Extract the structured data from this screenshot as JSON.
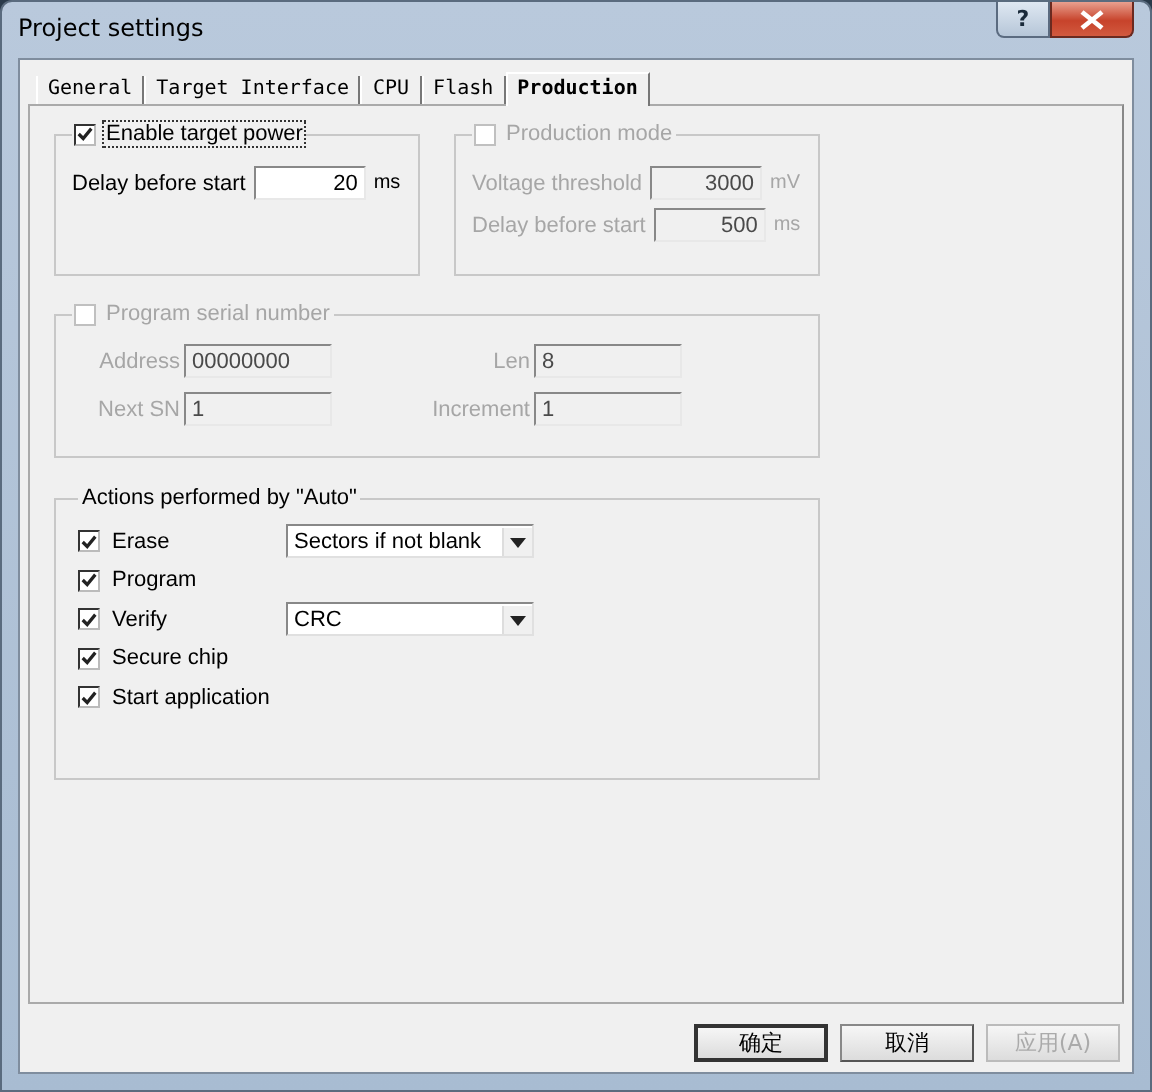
{
  "window": {
    "title": "Project settings",
    "help_button": "?"
  },
  "tabs": [
    {
      "label": "General",
      "selected": false
    },
    {
      "label": "Target Interface",
      "selected": false
    },
    {
      "label": "CPU",
      "selected": false
    },
    {
      "label": "Flash",
      "selected": false
    },
    {
      "label": "Production",
      "selected": true
    }
  ],
  "target_power": {
    "label": "Enable target power",
    "checked": true,
    "disabled": false,
    "fields": [
      {
        "label": "Delay before start",
        "value": "20",
        "unit": "ms"
      }
    ]
  },
  "production_mode": {
    "label": "Production mode",
    "checked": false,
    "disabled": true,
    "fields": [
      {
        "label": "Voltage threshold",
        "value": "3000",
        "unit": "mV"
      },
      {
        "label": "Delay before start",
        "value": "500",
        "unit": "ms"
      }
    ]
  },
  "serial_number": {
    "label": "Program serial number",
    "checked": false,
    "disabled": true,
    "fields": [
      {
        "label": "Address",
        "value": "00000000"
      },
      {
        "label": "Len",
        "value": "8"
      },
      {
        "label": "Next SN",
        "value": "1"
      },
      {
        "label": "Increment",
        "value": "1"
      }
    ]
  },
  "actions": {
    "title": "Actions performed by \"Auto\"",
    "items": [
      {
        "label": "Erase",
        "checked": true,
        "dropdown": "Sectors if not blank"
      },
      {
        "label": "Program",
        "checked": true
      },
      {
        "label": "Verify",
        "checked": true,
        "dropdown": "CRC"
      },
      {
        "label": "Secure chip",
        "checked": true
      },
      {
        "label": "Start application",
        "checked": true
      }
    ]
  },
  "buttons": [
    {
      "label": "确定",
      "disabled": false,
      "default": true
    },
    {
      "label": "取消",
      "disabled": false,
      "default": false
    },
    {
      "label": "应用(A)",
      "disabled": true,
      "default": false
    }
  ]
}
